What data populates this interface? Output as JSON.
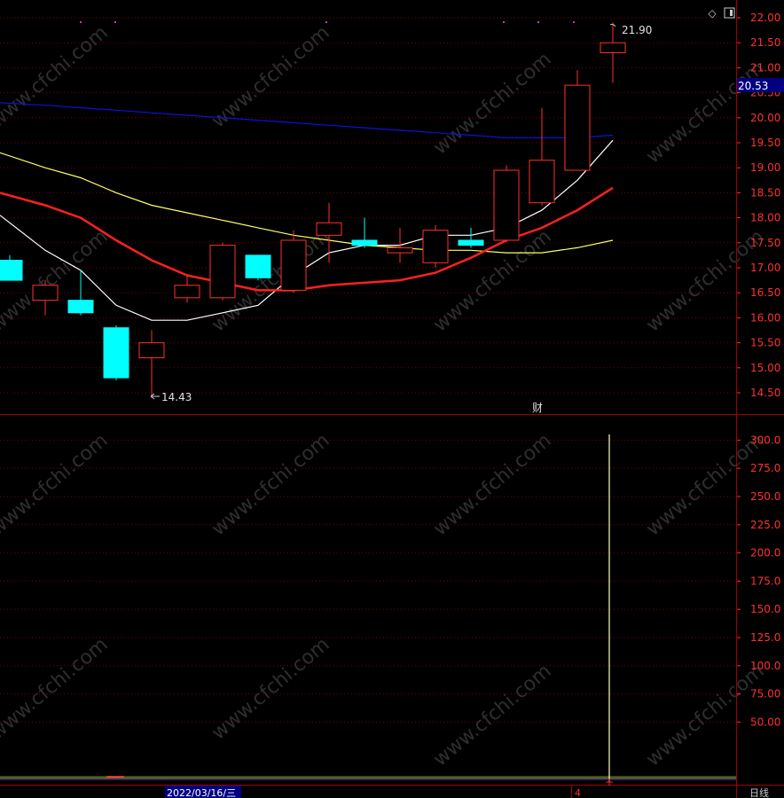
{
  "chart_data": {
    "type": "candlestick",
    "price_axis": {
      "ticks": [
        "22.00",
        "21.50",
        "21.00",
        "20.50",
        "20.00",
        "19.50",
        "19.00",
        "18.50",
        "18.00",
        "17.50",
        "17.00",
        "16.50",
        "16.00",
        "15.50",
        "15.00",
        "14.50"
      ],
      "ylim": [
        14.05,
        22.05
      ]
    },
    "current_price_label": "20.53",
    "high_label": "21.90",
    "low_label": "14.43",
    "candles": [
      {
        "open": 17.15,
        "close": 16.75,
        "high": 17.25,
        "low": 16.75,
        "color": "cyan"
      },
      {
        "open": 16.35,
        "close": 16.65,
        "high": 16.75,
        "low": 16.05,
        "color": "red"
      },
      {
        "open": 16.35,
        "close": 16.1,
        "high": 16.95,
        "low": 16.05,
        "color": "cyan"
      },
      {
        "open": 15.8,
        "close": 14.8,
        "high": 15.85,
        "low": 14.75,
        "color": "cyan"
      },
      {
        "open": 15.2,
        "close": 15.5,
        "high": 15.75,
        "low": 14.43,
        "color": "red"
      },
      {
        "open": 16.4,
        "close": 16.65,
        "high": 16.85,
        "low": 16.3,
        "color": "red"
      },
      {
        "open": 16.4,
        "close": 17.45,
        "high": 17.5,
        "low": 16.35,
        "color": "red"
      },
      {
        "open": 17.25,
        "close": 16.8,
        "high": 17.25,
        "low": 16.75,
        "color": "cyan"
      },
      {
        "open": 16.55,
        "close": 17.55,
        "high": 17.75,
        "low": 16.5,
        "color": "red"
      },
      {
        "open": 17.65,
        "close": 17.9,
        "high": 18.3,
        "low": 17.1,
        "color": "red"
      },
      {
        "open": 17.55,
        "close": 17.45,
        "high": 18.0,
        "low": 17.4,
        "color": "cyan"
      },
      {
        "open": 17.3,
        "close": 17.4,
        "high": 17.8,
        "low": 17.1,
        "color": "red"
      },
      {
        "open": 17.1,
        "close": 17.75,
        "high": 17.85,
        "low": 17.0,
        "color": "red"
      },
      {
        "open": 17.55,
        "close": 17.45,
        "high": 17.8,
        "low": 17.4,
        "color": "cyan"
      },
      {
        "open": 17.55,
        "close": 18.95,
        "high": 19.05,
        "low": 17.5,
        "color": "red"
      },
      {
        "open": 18.3,
        "close": 19.15,
        "high": 20.2,
        "low": 18.25,
        "color": "red"
      },
      {
        "open": 18.95,
        "close": 20.65,
        "high": 20.95,
        "low": 18.95,
        "color": "red"
      },
      {
        "open": 21.3,
        "close": 21.5,
        "high": 21.9,
        "low": 20.7,
        "color": "red"
      }
    ],
    "moving_averages": [
      {
        "color": "#ffffff",
        "values": [
          18.05,
          17.35,
          16.95,
          16.25,
          15.95,
          15.95,
          16.1,
          16.25,
          16.85,
          17.3,
          17.45,
          17.45,
          17.65,
          17.65,
          17.8,
          18.15,
          18.75,
          19.55
        ]
      },
      {
        "color": "#ffff66",
        "values": [
          19.3,
          19.0,
          18.8,
          18.5,
          18.25,
          18.1,
          17.95,
          17.8,
          17.65,
          17.55,
          17.45,
          17.4,
          17.35,
          17.35,
          17.3,
          17.3,
          17.4,
          17.55
        ]
      },
      {
        "color": "#ff2020",
        "values": [
          18.5,
          18.25,
          18.0,
          17.55,
          17.15,
          16.85,
          16.7,
          16.55,
          16.55,
          16.65,
          16.7,
          16.75,
          16.9,
          17.2,
          17.55,
          17.8,
          18.15,
          18.6
        ]
      },
      {
        "color": "#1010dd",
        "values": [
          20.3,
          20.25,
          20.2,
          20.15,
          20.1,
          20.05,
          20.0,
          19.95,
          19.9,
          19.85,
          19.8,
          19.75,
          19.7,
          19.65,
          19.6,
          19.6,
          19.6,
          19.65
        ]
      }
    ],
    "markers": [
      "财"
    ],
    "volume_axis": {
      "ticks": [
        "300.0",
        "275.0",
        "250.0",
        "225.0",
        "200.0",
        "175.0",
        "150.0",
        "125.0",
        "100.0",
        "75.00",
        "50.00"
      ],
      "ylim": [
        0,
        308
      ]
    },
    "volume_spike": 305,
    "date_label": "2022/03/16/三",
    "month_label": "4",
    "period_label": "日线",
    "watermark": "www.cfchi.com"
  },
  "colors": {
    "background": "#000000",
    "frame": "#a00000",
    "axis_text": "#ff3030",
    "grid": "#7a0000",
    "cyan": "#00ffff",
    "red": "#ff3030",
    "price_box": "#000080"
  }
}
